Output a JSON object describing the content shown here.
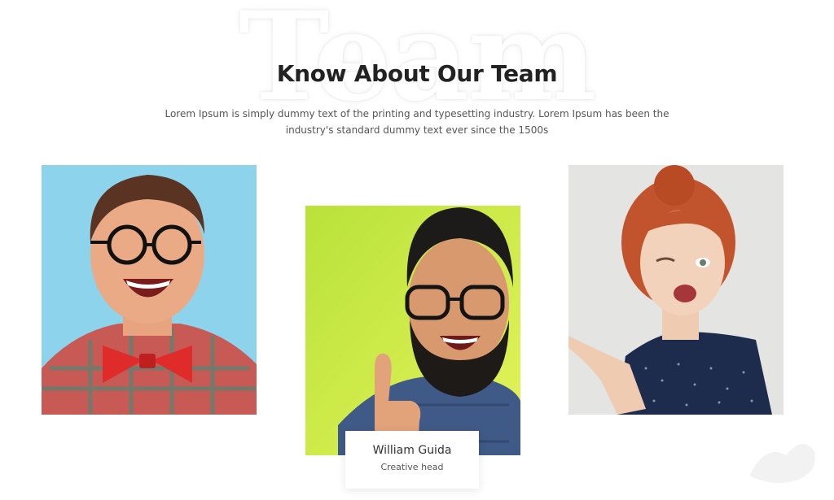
{
  "section": {
    "background_word": "Team",
    "title": "Know About Our Team",
    "description": "Lorem Ipsum is simply dummy text of the printing and typesetting industry. Lorem Ipsum has been the industry's standard dummy text ever since the 1500s"
  },
  "team": [
    {
      "photo_alt": "Laughing man with round glasses and red bow tie",
      "background": "#8ed3ec"
    },
    {
      "photo_alt": "Bearded man with glasses giving thumbs up",
      "background": "#c6e83a",
      "name": "William Guida",
      "role": "Creative head"
    },
    {
      "photo_alt": "Red-haired woman winking and pointing",
      "background": "#e4e4e2"
    }
  ],
  "colors": {
    "title": "#222222",
    "text": "#555555",
    "card_bg": "#ffffff"
  }
}
